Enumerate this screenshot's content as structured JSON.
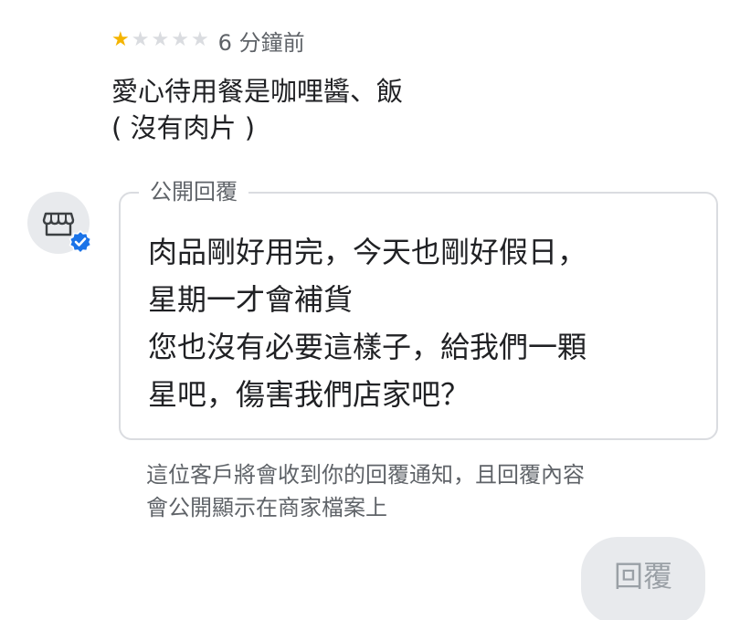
{
  "review": {
    "rating": 1,
    "max_rating": 5,
    "time_ago": "6 分鐘前",
    "text": "愛心待用餐是咖哩醬、飯\n( 沒有肉片 )"
  },
  "owner_reply": {
    "label": "公開回覆",
    "text": "肉品剛好用完，今天也剛好假日，\n星期一才會補貨\n您也沒有必要這樣子，給我們一顆\n星吧，傷害我們店家吧？"
  },
  "notice": "這位客戶將會收到你的回覆通知，且回覆內容\n會公開顯示在商家檔案上",
  "reply_button_label": "回覆",
  "icons": {
    "star": "star-icon",
    "avatar": "storefront-icon",
    "verified": "verified-check-icon"
  },
  "colors": {
    "star_filled": "#f4b400",
    "star_empty": "#dadce0",
    "verified": "#1a73e8",
    "border": "#dadce0",
    "button_bg": "#e8eaed",
    "button_text": "#9aa0a6"
  }
}
